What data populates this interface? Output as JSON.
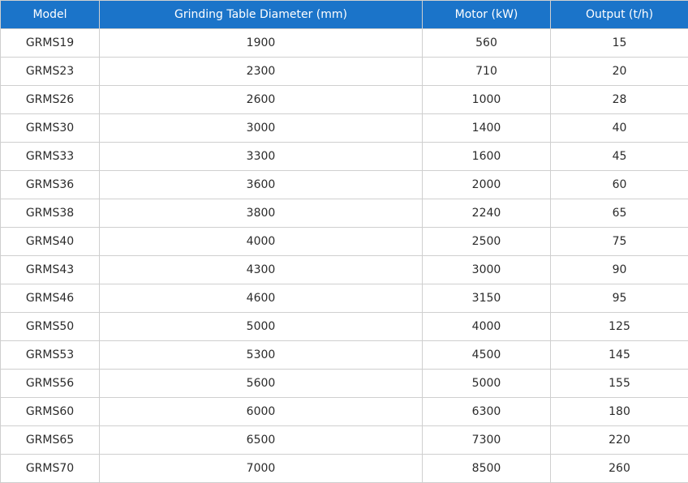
{
  "table": {
    "headers": [
      "Model",
      "Grinding Table Diameter (mm)",
      "Motor (kW)",
      "Output (t/h)"
    ],
    "rows": [
      [
        "GRMS19",
        "1900",
        "560",
        "15"
      ],
      [
        "GRMS23",
        "2300",
        "710",
        "20"
      ],
      [
        "GRMS26",
        "2600",
        "1000",
        "28"
      ],
      [
        "GRMS30",
        "3000",
        "1400",
        "40"
      ],
      [
        "GRMS33",
        "3300",
        "1600",
        "45"
      ],
      [
        "GRMS36",
        "3600",
        "2000",
        "60"
      ],
      [
        "GRMS38",
        "3800",
        "2240",
        "65"
      ],
      [
        "GRMS40",
        "4000",
        "2500",
        "75"
      ],
      [
        "GRMS43",
        "4300",
        "3000",
        "90"
      ],
      [
        "GRMS46",
        "4600",
        "3150",
        "95"
      ],
      [
        "GRMS50",
        "5000",
        "4000",
        "125"
      ],
      [
        "GRMS53",
        "5300",
        "4500",
        "145"
      ],
      [
        "GRMS56",
        "5600",
        "5000",
        "155"
      ],
      [
        "GRMS60",
        "6000",
        "6300",
        "180"
      ],
      [
        "GRMS65",
        "6500",
        "7300",
        "220"
      ],
      [
        "GRMS70",
        "7000",
        "8500",
        "260"
      ]
    ]
  },
  "colors": {
    "header_background": "#1b74c9",
    "header_text": "#ffffff",
    "cell_text": "#2b2b2b",
    "grid_lines": "#cfcfcf"
  }
}
